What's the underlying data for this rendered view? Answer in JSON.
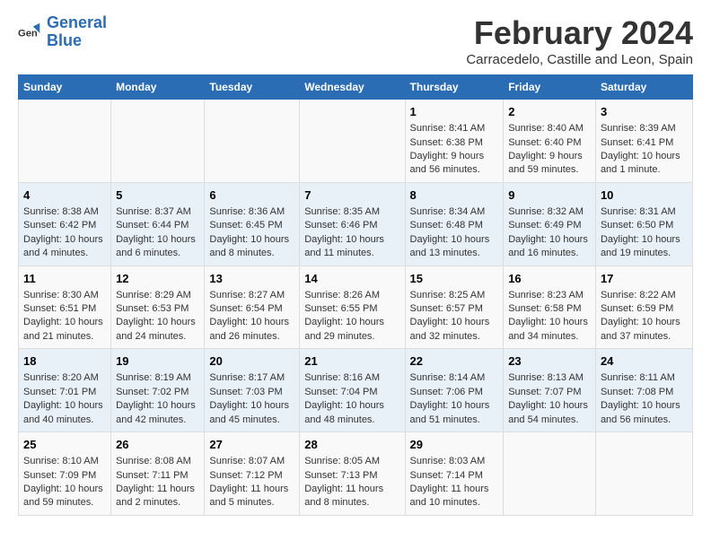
{
  "logo": {
    "line1": "General",
    "line2": "Blue"
  },
  "title": "February 2024",
  "subtitle": "Carracedelo, Castille and Leon, Spain",
  "days_of_week": [
    "Sunday",
    "Monday",
    "Tuesday",
    "Wednesday",
    "Thursday",
    "Friday",
    "Saturday"
  ],
  "weeks": [
    [
      {
        "day": "",
        "content": ""
      },
      {
        "day": "",
        "content": ""
      },
      {
        "day": "",
        "content": ""
      },
      {
        "day": "",
        "content": ""
      },
      {
        "day": "1",
        "content": "Sunrise: 8:41 AM\nSunset: 6:38 PM\nDaylight: 9 hours and 56 minutes."
      },
      {
        "day": "2",
        "content": "Sunrise: 8:40 AM\nSunset: 6:40 PM\nDaylight: 9 hours and 59 minutes."
      },
      {
        "day": "3",
        "content": "Sunrise: 8:39 AM\nSunset: 6:41 PM\nDaylight: 10 hours and 1 minute."
      }
    ],
    [
      {
        "day": "4",
        "content": "Sunrise: 8:38 AM\nSunset: 6:42 PM\nDaylight: 10 hours and 4 minutes."
      },
      {
        "day": "5",
        "content": "Sunrise: 8:37 AM\nSunset: 6:44 PM\nDaylight: 10 hours and 6 minutes."
      },
      {
        "day": "6",
        "content": "Sunrise: 8:36 AM\nSunset: 6:45 PM\nDaylight: 10 hours and 8 minutes."
      },
      {
        "day": "7",
        "content": "Sunrise: 8:35 AM\nSunset: 6:46 PM\nDaylight: 10 hours and 11 minutes."
      },
      {
        "day": "8",
        "content": "Sunrise: 8:34 AM\nSunset: 6:48 PM\nDaylight: 10 hours and 13 minutes."
      },
      {
        "day": "9",
        "content": "Sunrise: 8:32 AM\nSunset: 6:49 PM\nDaylight: 10 hours and 16 minutes."
      },
      {
        "day": "10",
        "content": "Sunrise: 8:31 AM\nSunset: 6:50 PM\nDaylight: 10 hours and 19 minutes."
      }
    ],
    [
      {
        "day": "11",
        "content": "Sunrise: 8:30 AM\nSunset: 6:51 PM\nDaylight: 10 hours and 21 minutes."
      },
      {
        "day": "12",
        "content": "Sunrise: 8:29 AM\nSunset: 6:53 PM\nDaylight: 10 hours and 24 minutes."
      },
      {
        "day": "13",
        "content": "Sunrise: 8:27 AM\nSunset: 6:54 PM\nDaylight: 10 hours and 26 minutes."
      },
      {
        "day": "14",
        "content": "Sunrise: 8:26 AM\nSunset: 6:55 PM\nDaylight: 10 hours and 29 minutes."
      },
      {
        "day": "15",
        "content": "Sunrise: 8:25 AM\nSunset: 6:57 PM\nDaylight: 10 hours and 32 minutes."
      },
      {
        "day": "16",
        "content": "Sunrise: 8:23 AM\nSunset: 6:58 PM\nDaylight: 10 hours and 34 minutes."
      },
      {
        "day": "17",
        "content": "Sunrise: 8:22 AM\nSunset: 6:59 PM\nDaylight: 10 hours and 37 minutes."
      }
    ],
    [
      {
        "day": "18",
        "content": "Sunrise: 8:20 AM\nSunset: 7:01 PM\nDaylight: 10 hours and 40 minutes."
      },
      {
        "day": "19",
        "content": "Sunrise: 8:19 AM\nSunset: 7:02 PM\nDaylight: 10 hours and 42 minutes."
      },
      {
        "day": "20",
        "content": "Sunrise: 8:17 AM\nSunset: 7:03 PM\nDaylight: 10 hours and 45 minutes."
      },
      {
        "day": "21",
        "content": "Sunrise: 8:16 AM\nSunset: 7:04 PM\nDaylight: 10 hours and 48 minutes."
      },
      {
        "day": "22",
        "content": "Sunrise: 8:14 AM\nSunset: 7:06 PM\nDaylight: 10 hours and 51 minutes."
      },
      {
        "day": "23",
        "content": "Sunrise: 8:13 AM\nSunset: 7:07 PM\nDaylight: 10 hours and 54 minutes."
      },
      {
        "day": "24",
        "content": "Sunrise: 8:11 AM\nSunset: 7:08 PM\nDaylight: 10 hours and 56 minutes."
      }
    ],
    [
      {
        "day": "25",
        "content": "Sunrise: 8:10 AM\nSunset: 7:09 PM\nDaylight: 10 hours and 59 minutes."
      },
      {
        "day": "26",
        "content": "Sunrise: 8:08 AM\nSunset: 7:11 PM\nDaylight: 11 hours and 2 minutes."
      },
      {
        "day": "27",
        "content": "Sunrise: 8:07 AM\nSunset: 7:12 PM\nDaylight: 11 hours and 5 minutes."
      },
      {
        "day": "28",
        "content": "Sunrise: 8:05 AM\nSunset: 7:13 PM\nDaylight: 11 hours and 8 minutes."
      },
      {
        "day": "29",
        "content": "Sunrise: 8:03 AM\nSunset: 7:14 PM\nDaylight: 11 hours and 10 minutes."
      },
      {
        "day": "",
        "content": ""
      },
      {
        "day": "",
        "content": ""
      }
    ]
  ]
}
